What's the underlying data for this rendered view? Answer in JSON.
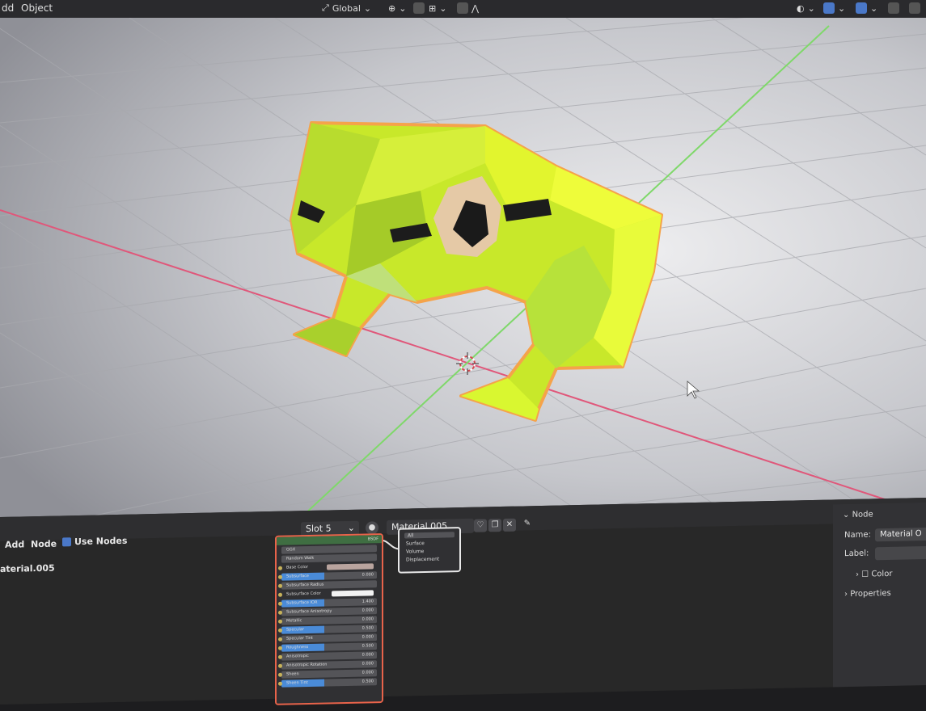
{
  "topbar": {
    "menu_add": "dd",
    "menu_object": "Object",
    "orientation": "Global"
  },
  "node_editor": {
    "menu_add": "Add",
    "menu_node": "Node",
    "use_nodes": "Use Nodes",
    "material_label": "aterial.005",
    "slot": "Slot 5",
    "material_name": "Material.005",
    "bsdf": {
      "title": "BSDF",
      "rows": [
        {
          "label": "GGX",
          "value": ""
        },
        {
          "label": "Random Walk",
          "value": ""
        },
        {
          "label": "Base Color",
          "value": ""
        },
        {
          "label": "Subsurface",
          "value": "0.000"
        },
        {
          "label": "Subsurface Radius",
          "value": ""
        },
        {
          "label": "Subsurface Color",
          "value": ""
        },
        {
          "label": "Subsurface IOR",
          "value": "1.400"
        },
        {
          "label": "Subsurface Anisotropy",
          "value": "0.000"
        },
        {
          "label": "Metallic",
          "value": "0.000"
        },
        {
          "label": "Specular",
          "value": "0.500"
        },
        {
          "label": "Specular Tint",
          "value": "0.000"
        },
        {
          "label": "Roughness",
          "value": "0.500"
        },
        {
          "label": "Anisotropic",
          "value": "0.000"
        },
        {
          "label": "Anisotropic Rotation",
          "value": "0.000"
        },
        {
          "label": "Sheen",
          "value": "0.000"
        },
        {
          "label": "Sheen Tint",
          "value": "0.500"
        }
      ]
    },
    "output_node": {
      "target": "All",
      "sockets": [
        "Surface",
        "Volume",
        "Displacement"
      ]
    },
    "sidebar": {
      "section": "Node",
      "name_label": "Name:",
      "name_value": "Material O",
      "label_label": "Label:",
      "color": "Color",
      "properties": "Properties"
    }
  },
  "colors": {
    "frog": "#c8e82a",
    "selection_outline": "#f5a34a",
    "x_axis": "#e0577a",
    "y_axis": "#7fd86a"
  }
}
